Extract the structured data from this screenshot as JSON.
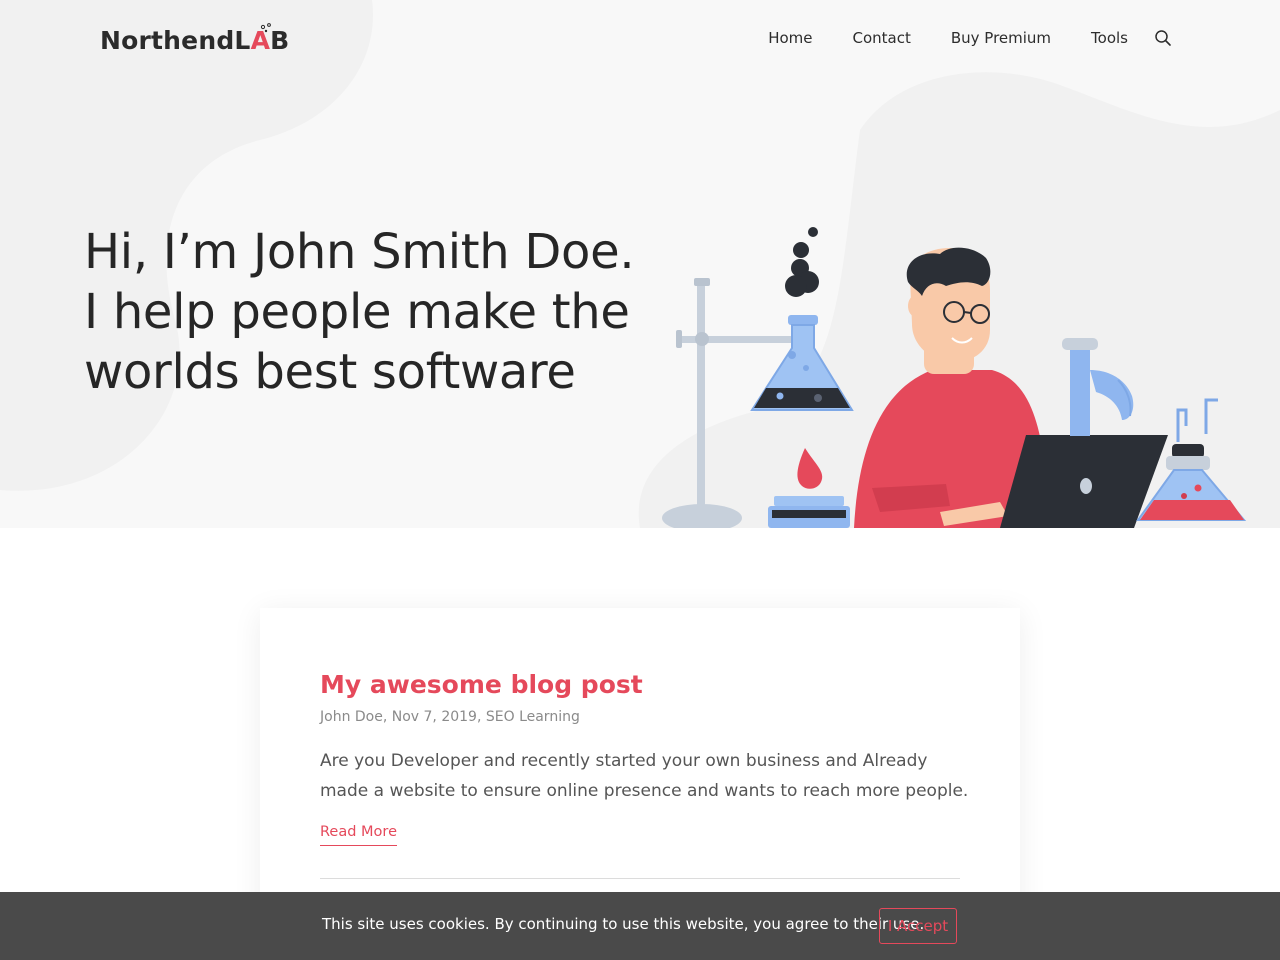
{
  "header": {
    "logo_text_main": "NorthendL",
    "logo_text_a": "A",
    "logo_text_end": "B",
    "nav": [
      {
        "label": "Home"
      },
      {
        "label": "Contact"
      },
      {
        "label": "Buy Premium"
      },
      {
        "label": "Tools"
      }
    ],
    "search_icon": "search-icon"
  },
  "hero": {
    "lines": [
      "Hi, I’m John Smith Doe.",
      "I help people make the",
      "worlds best software"
    ],
    "illustration": "scientist-lab-illustration"
  },
  "post": {
    "title": "My awesome blog post",
    "meta": "John Doe, Nov 7, 2019, SEO Learning",
    "excerpt": "Are you Developer and recently started your own business and Already made a website to ensure online presence and wants to reach more people.",
    "read_more": "Read More"
  },
  "cookie": {
    "text": "This site uses cookies. By continuing to use this website, you agree to their use.",
    "accept_label": "I Accept"
  },
  "colors": {
    "accent": "#e5495b",
    "hero_bg": "#f8f8f8",
    "cookie_bg": "#4a4a4a",
    "text_dark": "#262626"
  }
}
